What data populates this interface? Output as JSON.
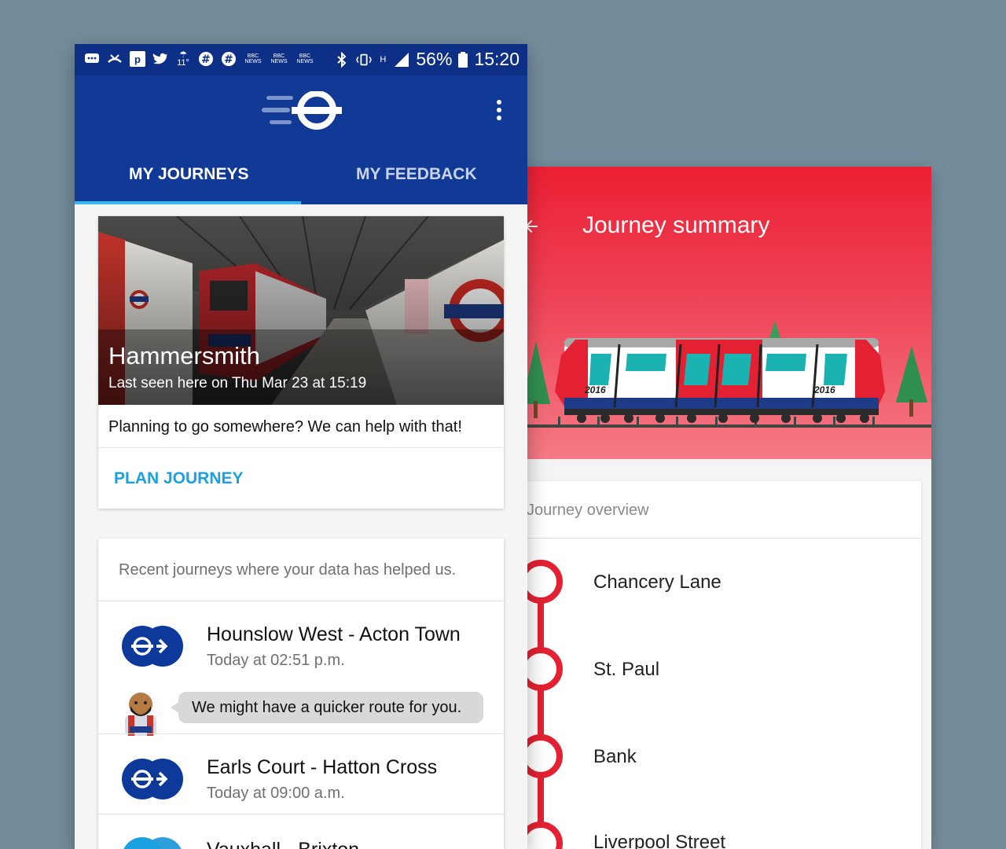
{
  "status_bar": {
    "icons": [
      "message-icon",
      "missed-call-icon",
      "parking-icon",
      "twitter-icon",
      "weather-icon",
      "slack-icon",
      "slack-icon",
      "bbc-news-icon",
      "bbc-news-icon",
      "bbc-news-icon",
      "bluetooth-icon",
      "vibrate-icon",
      "hspa-icon",
      "signal-icon",
      "battery-icon"
    ],
    "temperature": "11°",
    "news_label": "BBC NEWS",
    "battery": "56%",
    "time": "15:20"
  },
  "app_bar": {
    "logo": "tfl-roundel-logo",
    "menu_icon": "more-vertical-icon"
  },
  "tabs": [
    {
      "label": "MY JOURNEYS",
      "active": true
    },
    {
      "label": "MY FEEDBACK",
      "active": false
    }
  ],
  "hero_card": {
    "station": "Hammersmith",
    "last_seen": "Last seen here on Thu Mar 23 at 15:19",
    "question": "Planning to go somewhere? We can help with that!",
    "action": "PLAN JOURNEY"
  },
  "recent_card": {
    "header": "Recent journeys where your data has helped us.",
    "journeys": [
      {
        "title": "Hounslow West - Acton Town",
        "time": "Today at 02:51 p.m."
      },
      {
        "title": "Earls Court - Hatton Cross",
        "time": "Today at 09:00 a.m."
      },
      {
        "title": "Vauxhall - Brixton",
        "time": ""
      }
    ],
    "suggestion": "We might have a quicker route for you."
  },
  "summary": {
    "title": "Journey summary",
    "train_year": "2016",
    "overview_label": "Journey overview",
    "stops": [
      "Chancery Lane",
      "St. Paul",
      "Bank",
      "Liverpool Street"
    ]
  },
  "colors": {
    "tfl_blue": "#113a97",
    "status_blue": "#0d2f86",
    "accent_blue": "#1ba1e2",
    "central_red": "#e32132"
  }
}
